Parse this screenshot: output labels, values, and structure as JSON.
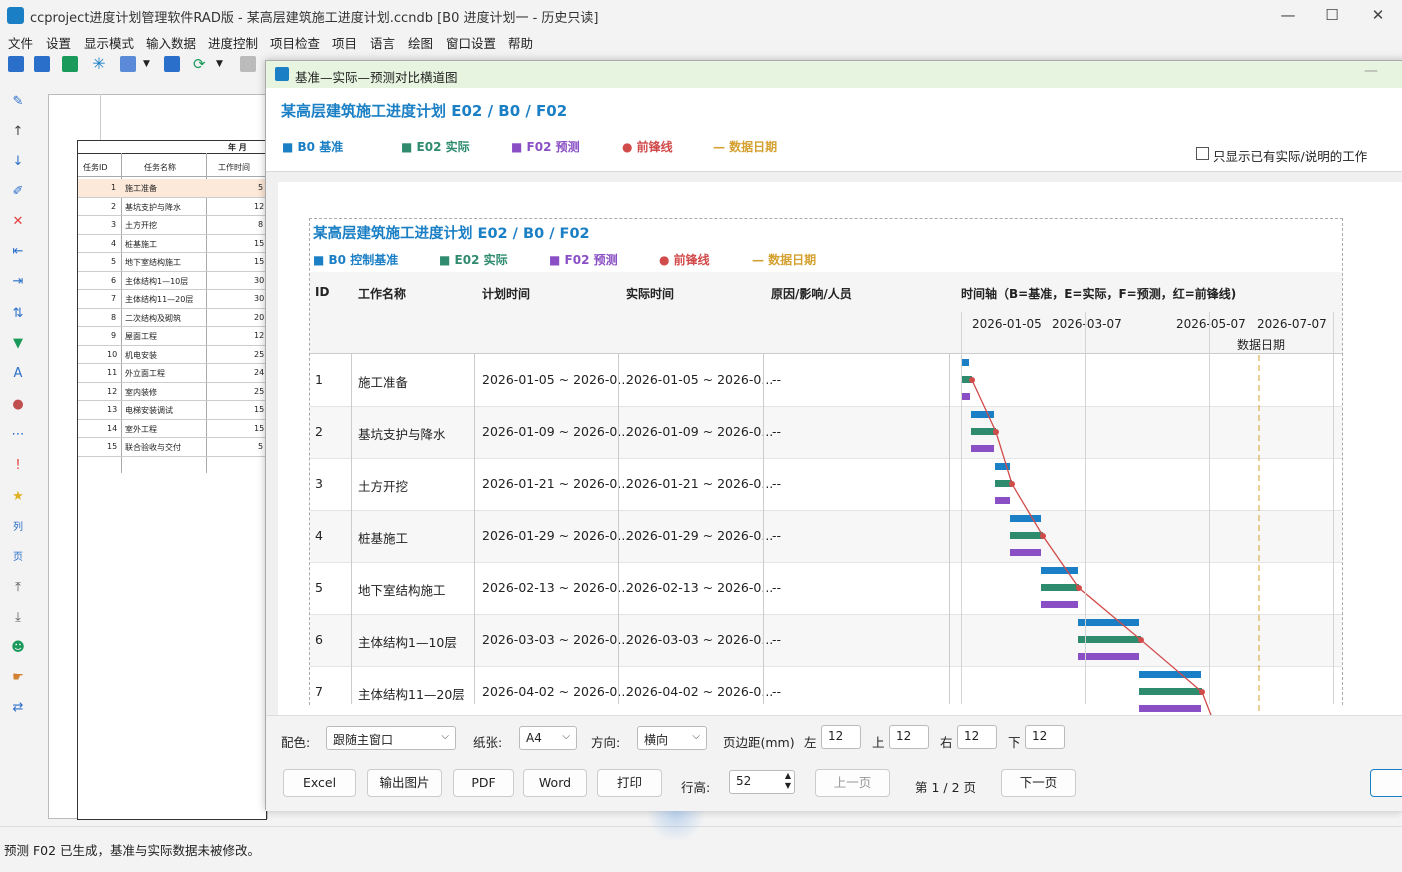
{
  "app": {
    "title": "ccproject进度计划管理软件RAD版 - 某高层建筑施工进度计划.ccndb [B0 进度计划一 - 历史只读]",
    "minimize": "—",
    "maximize": "☐",
    "close": "✕"
  },
  "menu": [
    "文件",
    "设置",
    "显示模式",
    "输入数据",
    "进度控制",
    "项目检查",
    "项目",
    "语言",
    "绘图",
    "窗口设置",
    "帮助"
  ],
  "bg_sheet": {
    "header_month": "年 月",
    "columns": [
      "任务ID",
      "任务名称",
      "工作时间"
    ],
    "rows": [
      [
        "1",
        "施工准备",
        "5"
      ],
      [
        "2",
        "基坑支护与降水",
        "12"
      ],
      [
        "3",
        "土方开挖",
        "8"
      ],
      [
        "4",
        "桩基施工",
        "15"
      ],
      [
        "5",
        "地下室结构施工",
        "15"
      ],
      [
        "6",
        "主体结构1—10层",
        "30"
      ],
      [
        "7",
        "主体结构11—20层",
        "30"
      ],
      [
        "8",
        "二次结构及砌筑",
        "20"
      ],
      [
        "9",
        "屋面工程",
        "12"
      ],
      [
        "10",
        "机电安装",
        "25"
      ],
      [
        "11",
        "外立面工程",
        "24"
      ],
      [
        "12",
        "室内装修",
        "25"
      ],
      [
        "13",
        "电梯安装调试",
        "15"
      ],
      [
        "14",
        "室外工程",
        "15"
      ],
      [
        "15",
        "联合验收与交付",
        "5"
      ]
    ]
  },
  "status": "预测 F02 已生成，基准与实际数据未被修改。",
  "dialog": {
    "title": "基准—实际—预测对比横道图",
    "header_title": "某高层建筑施工进度计划    E02 / B0 / F02",
    "legend": [
      {
        "text": "■ B0 基准",
        "color": "#1a7fc4"
      },
      {
        "text": "■ E02 实际",
        "color": "#2e8b6e"
      },
      {
        "text": "■ F02 预测",
        "color": "#8a4fc4"
      },
      {
        "text": "● 前锋线",
        "color": "#d24b4b"
      },
      {
        "text": "— 数据日期",
        "color": "#d4a030"
      }
    ],
    "only_checkbox": "只显示已有实际/说明的工作",
    "page": {
      "title": "某高层建筑施工进度计划    E02 / B0 / F02",
      "legend": [
        {
          "text": "■ B0 控制基准",
          "color": "#1a7fc4"
        },
        {
          "text": "■ E02 实际",
          "color": "#2e8b6e"
        },
        {
          "text": "■ F02 预测",
          "color": "#8a4fc4"
        },
        {
          "text": "● 前锋线",
          "color": "#d24b4b"
        },
        {
          "text": "— 数据日期",
          "color": "#d4a030"
        }
      ],
      "columns": [
        "ID",
        "工作名称",
        "计划时间",
        "实际时间",
        "原因/影响/人员",
        "时间轴（B=基准，E=实际，F=预测，红=前锋线)"
      ],
      "ticks": [
        "2026-01-05",
        "2026-03-07",
        "2026-05-07",
        "2026-07-07"
      ],
      "data_date_label": "数据日期",
      "rows": [
        {
          "id": "1",
          "name": "施工准备",
          "plan": "2026-01-05 ~ 2026-0...",
          "actual": "2026-01-05 ~ 2026-0...",
          "reason": "--"
        },
        {
          "id": "2",
          "name": "基坑支护与降水",
          "plan": "2026-01-09 ~ 2026-0...",
          "actual": "2026-01-09 ~ 2026-0...",
          "reason": "--"
        },
        {
          "id": "3",
          "name": "土方开挖",
          "plan": "2026-01-21 ~ 2026-0...",
          "actual": "2026-01-21 ~ 2026-0...",
          "reason": "--"
        },
        {
          "id": "4",
          "name": "桩基施工",
          "plan": "2026-01-29 ~ 2026-0...",
          "actual": "2026-01-29 ~ 2026-0...",
          "reason": "--"
        },
        {
          "id": "5",
          "name": "地下室结构施工",
          "plan": "2026-02-13 ~ 2026-0...",
          "actual": "2026-02-13 ~ 2026-0...",
          "reason": "--"
        },
        {
          "id": "6",
          "name": "主体结构1—10层",
          "plan": "2026-03-03 ~ 2026-0...",
          "actual": "2026-03-03 ~ 2026-0...",
          "reason": "--"
        },
        {
          "id": "7",
          "name": "主体结构11—20层",
          "plan": "2026-04-02 ~ 2026-0...",
          "actual": "2026-04-02 ~ 2026-0...",
          "reason": "--"
        }
      ]
    },
    "controls": {
      "color_label": "配色:",
      "color_value": "跟随主窗口",
      "paper_label": "纸张:",
      "paper_value": "A4",
      "orient_label": "方向:",
      "orient_value": "横向",
      "margin_label": "页边距(mm)",
      "left_label": "左",
      "left": "12",
      "top_label": "上",
      "top": "12",
      "right_label": "右",
      "right": "12",
      "bottom_label": "下",
      "bottom": "12",
      "btn_excel": "Excel",
      "btn_image": "输出图片",
      "btn_pdf": "PDF",
      "btn_word": "Word",
      "btn_print": "打印",
      "row_height_label": "行高:",
      "row_height": "52",
      "btn_prev": "上一页",
      "page_info": "第 1 / 2 页",
      "btn_next": "下一页"
    }
  },
  "colors": {
    "accent": "#1a7fc4",
    "actual": "#2e8b6e",
    "forecast": "#8a4fc4",
    "frontline": "#d24b4b",
    "data_date": "#d4a030"
  }
}
